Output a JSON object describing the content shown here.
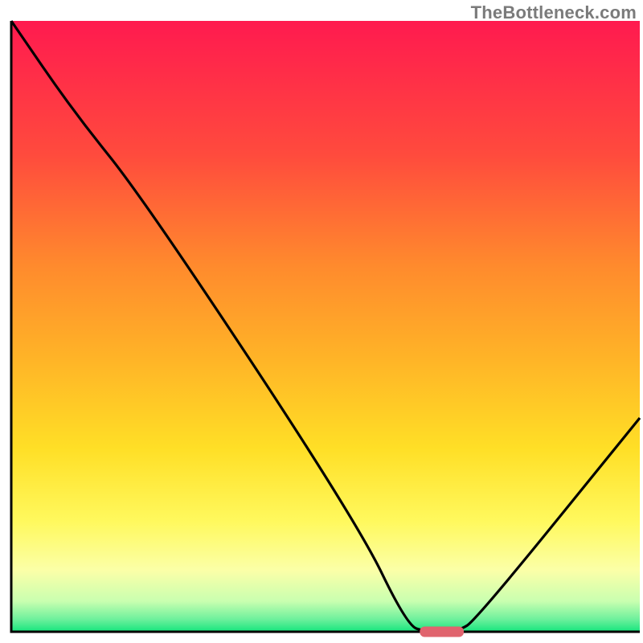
{
  "watermark": "TheBottleneck.com",
  "chart_data": {
    "type": "line",
    "title": "",
    "xlabel": "",
    "ylabel": "",
    "xlim": [
      0,
      100
    ],
    "ylim": [
      0,
      100
    ],
    "series": [
      {
        "name": "bottleneck-curve",
        "x": [
          0,
          10,
          21,
          55,
          63,
          66,
          71,
          74,
          100
        ],
        "values": [
          100,
          85,
          71,
          18,
          1,
          0,
          0,
          2,
          35
        ]
      }
    ],
    "optimal_marker": {
      "x_start": 65,
      "x_end": 72,
      "y": 0
    },
    "gradient_bands": [
      {
        "y": 0,
        "color": "#ff1a4f"
      },
      {
        "y": 22,
        "color": "#ff4b3d"
      },
      {
        "y": 40,
        "color": "#ff8a2d"
      },
      {
        "y": 55,
        "color": "#ffb327"
      },
      {
        "y": 70,
        "color": "#ffdf26"
      },
      {
        "y": 82,
        "color": "#fff95e"
      },
      {
        "y": 90,
        "color": "#fbffa8"
      },
      {
        "y": 95,
        "color": "#c9ffb0"
      },
      {
        "y": 98,
        "color": "#6cf09c"
      },
      {
        "y": 100,
        "color": "#15e57d"
      }
    ],
    "axis_color": "#000000",
    "marker_color": "#e0646e"
  }
}
